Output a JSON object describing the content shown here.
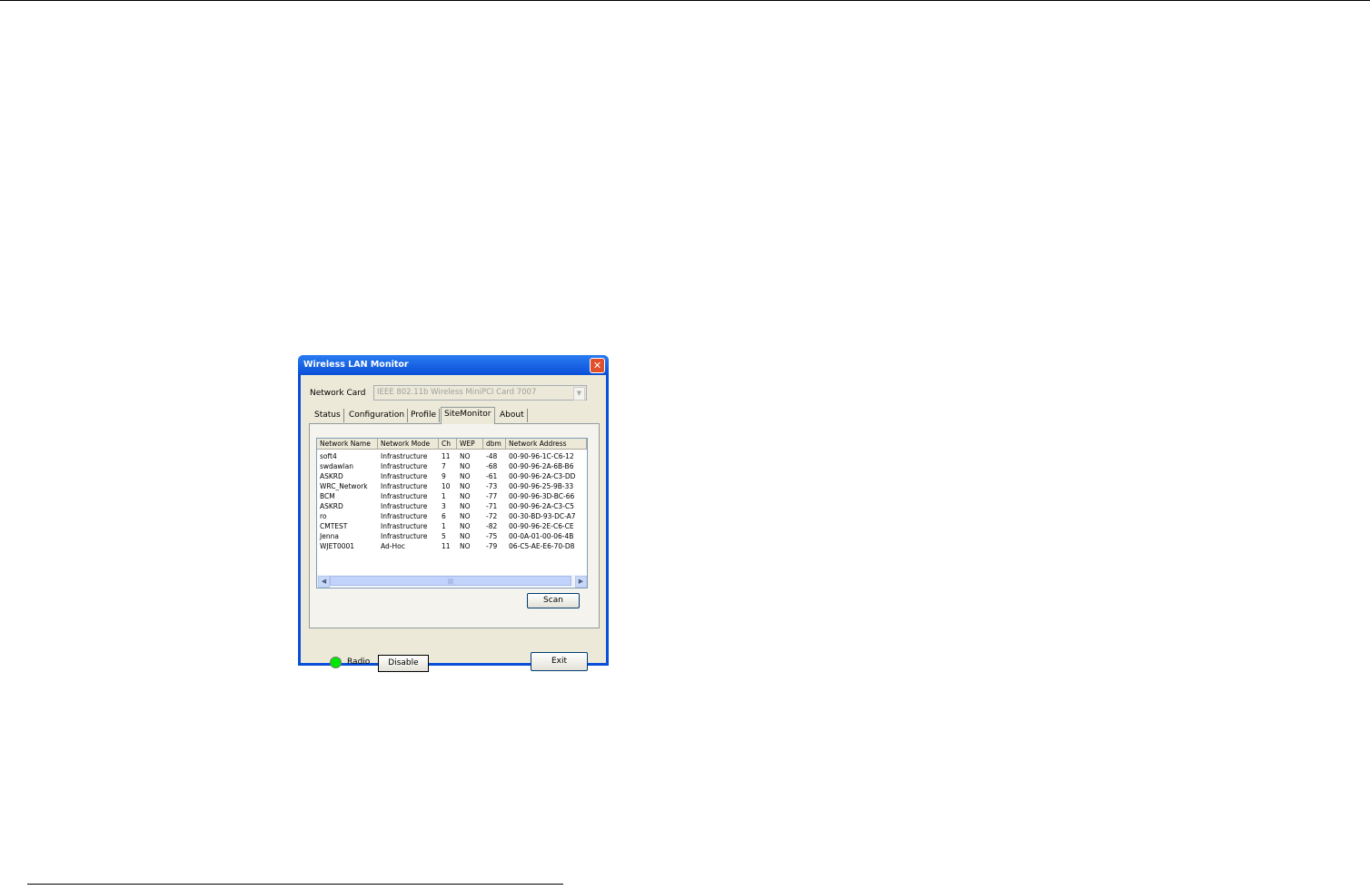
{
  "window": {
    "title": "Wireless LAN Monitor",
    "close_icon": "close-icon"
  },
  "network_card": {
    "label": "Network Card",
    "value": "IEEE 802.11b Wireless MiniPCI Card 7007"
  },
  "tabs": [
    {
      "label": "Status"
    },
    {
      "label": "Configuration"
    },
    {
      "label": "Profile"
    },
    {
      "label": "SiteMonitor",
      "selected": true
    },
    {
      "label": "About"
    }
  ],
  "table": {
    "columns": [
      "Network Name",
      "Network Mode",
      "Ch",
      "WEP",
      "dbm",
      "Network Address"
    ],
    "rows": [
      [
        "soft4",
        "Infrastructure",
        "11",
        "NO",
        "-48",
        "00-90-96-1C-C6-12"
      ],
      [
        "swdawlan",
        "Infrastructure",
        "7",
        "NO",
        "-68",
        "00-90-96-2A-6B-B6"
      ],
      [
        "ASKRD",
        "Infrastructure",
        "9",
        "NO",
        "-61",
        "00-90-96-2A-C3-DD"
      ],
      [
        "WRC_Network",
        "Infrastructure",
        "10",
        "NO",
        "-73",
        "00-90-96-25-9B-33"
      ],
      [
        "BCM",
        "Infrastructure",
        "1",
        "NO",
        "-77",
        "00-90-96-3D-BC-66"
      ],
      [
        "ASKRD",
        "Infrastructure",
        "3",
        "NO",
        "-71",
        "00-90-96-2A-C3-C5"
      ],
      [
        "ro",
        "Infrastructure",
        "6",
        "NO",
        "-72",
        "00-30-BD-93-DC-A7"
      ],
      [
        "CMTEST",
        "Infrastructure",
        "1",
        "NO",
        "-82",
        "00-90-96-2E-C6-CE"
      ],
      [
        "Jenna",
        "Infrastructure",
        "5",
        "NO",
        "-75",
        "00-0A-01-00-06-4B"
      ],
      [
        "WJET0001",
        "Ad-Hoc",
        "11",
        "NO",
        "-79",
        "06-C5-AE-E6-70-D8"
      ]
    ]
  },
  "buttons": {
    "scan": "Scan",
    "disable": "Disable",
    "exit": "Exit"
  },
  "radio": {
    "label": "Radio",
    "status_color": "#00e800"
  }
}
